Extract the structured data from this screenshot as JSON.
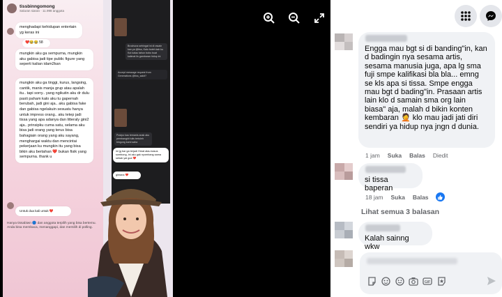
{
  "viewer": {
    "tools": [
      {
        "icon": "zoom-in-icon"
      },
      {
        "icon": "zoom-out-icon"
      },
      {
        "icon": "fullscreen-icon"
      }
    ],
    "post": {
      "account_name": "tissbinngomong",
      "account_sub": "Saluran siaran · 11.998 anggota",
      "msg1": "menghadapi kehidupan entertain yg keras ini",
      "reaction": "❤️😂😂 58",
      "msg2": "mungkin aku ga sempurna, mungkin aku gabisa jadi tipe public figure yang seperti kalian idam2kan",
      "msg3": "mungkin aku ga tinggi, kurus, langsing, cantik, manis manja grup atau apalah itu.. tapi sorry.. yang ngikutin aku dr dulu pasti paham kalo aku tu gapernah berubah, jadi gini aja.. aku gabisa fake dan gabisa ngelakuin sesuatu hanya untuk impress orang.. aku tetep jadi tissa yang apa adanya dan litteraly gini2 aja.. prinsipku cuma satu, selama aku bisa jadi orang yang terus bisa bahagiain orang yang aku sayang, menghargai waktu dan mencintai pekerjaan ku mungkin itu yang bisa bikin aku bertahan ❤️ bukan fisik yang sempurna. thank u",
      "msg4": "Untuk dua kali untuk ❤️",
      "footer": "Hanya tissabiwn 🔵 dan anggota terpilih yang bisa bertemu. Anda bisa membaca, menanggapi, dan memilih di polling.",
      "dark_msg1": "Brochuna sehingat ini di rasain kan ya @tiss, Kalo boleh kah ku Kut kalau tahun bobo buat kalimat lis gambaran hidup ini",
      "dark_banner": "Accept message request from Generations @tiss_sakit?",
      "dark_msg2": "Postpo kau temanis anak aku pembangkit tulis tertoleh bingung kami saha",
      "right_bub1": "ini jg bar ga terjadi Hmat atau kasus sombong, ini aku gak nyombang sama sebab yai gue ❤️",
      "right_bub2": "gimana ❤️"
    }
  },
  "topbar": {
    "apps_icon": "grid-menu-icon",
    "messenger_icon": "messenger-icon"
  },
  "comments": [
    {
      "text": "Engga mau bgt si di banding\"in, kan d badingin nya sesama artis, sesama manusia juga, apa lg sma fuji smpe kalifikasi bla bla... emng se kls apa si tissa. Smpe engga mau bgt d bading\"in. Prasaan artis lain klo d samain sma org lain biasa\" aja, malah d bikin konten kembaran 🤦 klo mau jadi jati diri sendiri ya hidup nya jngn d dunia.",
      "time": "1 jam",
      "like": "Suka",
      "reply": "Balas",
      "edited": "Diedit"
    },
    {
      "name_blur": "...",
      "text": "si tissa baperan",
      "time": "18 jam",
      "like": "Suka",
      "reply": "Balas",
      "reaction_icon": "like-icon"
    }
  ],
  "see_all": "Lihat semua 3 balasan",
  "comment3": {
    "text": "Kalah sainng wkw"
  },
  "composer": {
    "icons": [
      "sticker-icon",
      "avatar-sticker-icon",
      "emoji-icon",
      "camera-icon",
      "gif-icon",
      "star-sticker-icon"
    ],
    "send_icon": "send-icon"
  }
}
